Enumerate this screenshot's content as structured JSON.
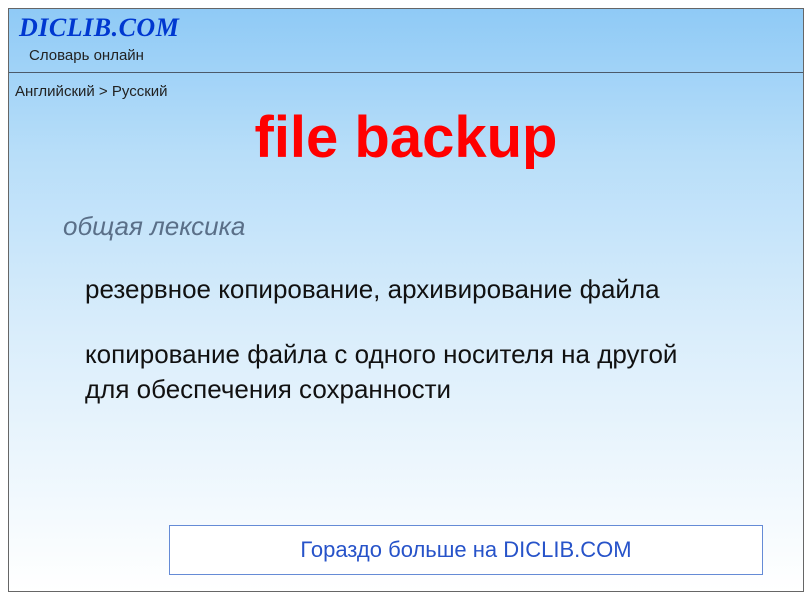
{
  "header": {
    "site_title": "DICLIB.COM",
    "site_subtitle": "Словарь онлайн"
  },
  "breadcrumb": "Английский > Русский",
  "term": "file backup",
  "entry": {
    "domain_label": "общая лексика",
    "definitions": [
      "резервное копирование, архивирование файла",
      "копирование файла с одного носителя на другой для обеспечения сохранности"
    ]
  },
  "more_bar": "Гораздо больше на DICLIB.COM"
}
